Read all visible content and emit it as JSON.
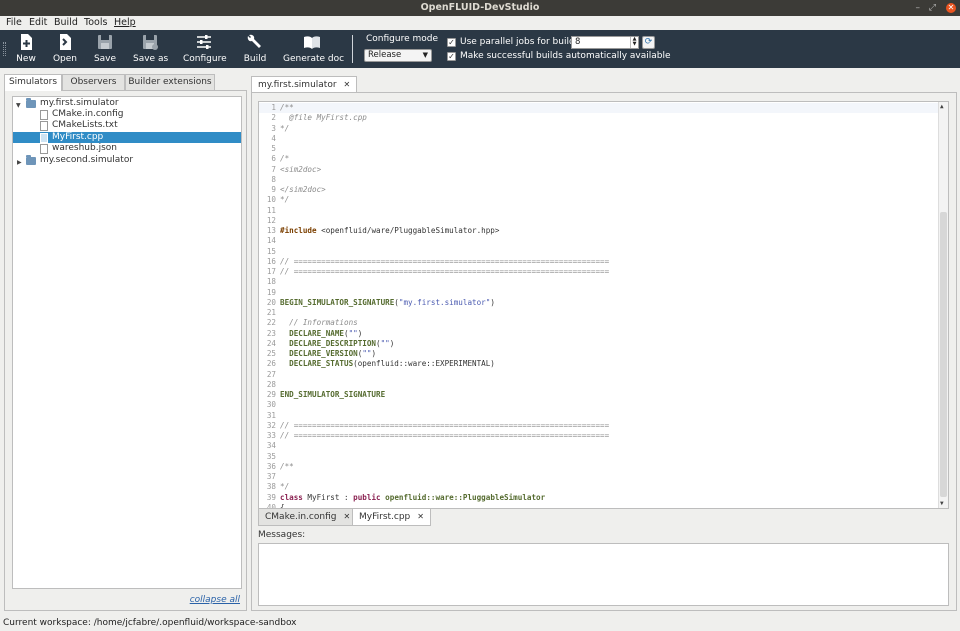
{
  "window": {
    "title": "OpenFLUID-DevStudio",
    "minimize": "–",
    "restore": "⤢",
    "close": "✕"
  },
  "menu": [
    "File",
    "Edit",
    "Build",
    "Tools",
    "Help"
  ],
  "toolbar": {
    "buttons": [
      {
        "label": "New",
        "icon": "new-file-icon"
      },
      {
        "label": "Open",
        "icon": "open-file-icon"
      },
      {
        "label": "Save",
        "icon": "save-icon"
      },
      {
        "label": "Save as",
        "icon": "save-as-icon"
      },
      {
        "label": "Configure",
        "icon": "configure-sliders-icon"
      },
      {
        "label": "Build",
        "icon": "wrench-icon"
      },
      {
        "label": "Generate doc",
        "icon": "book-icon"
      }
    ],
    "configure_mode_label": "Configure mode",
    "configure_mode_value": "Release",
    "parallel_jobs_label": "Use parallel jobs for build :",
    "parallel_jobs_value": "8",
    "parallel_jobs_checked": true,
    "auto_available_label": "Make successful builds automatically available",
    "auto_available_checked": true
  },
  "left_tabs": [
    "Simulators",
    "Observers",
    "Builder extensions"
  ],
  "tree": [
    {
      "label": "my.first.simulator",
      "type": "folder",
      "expanded": true,
      "depth": 0
    },
    {
      "label": "CMake.in.config",
      "type": "file",
      "depth": 1
    },
    {
      "label": "CMakeLists.txt",
      "type": "file",
      "depth": 1
    },
    {
      "label": "MyFirst.cpp",
      "type": "file",
      "depth": 1,
      "selected": true
    },
    {
      "label": "wareshub.json",
      "type": "file",
      "depth": 1
    },
    {
      "label": "my.second.simulator",
      "type": "folder",
      "expanded": false,
      "depth": 0
    }
  ],
  "collapse_all": "collapse all",
  "editor_tab": "my.first.simulator",
  "code_lines": [
    [
      [
        "c-comment",
        "/**"
      ]
    ],
    [
      [
        "c-comment",
        "  @file MyFirst.cpp"
      ]
    ],
    [
      [
        "c-comment",
        "*/"
      ]
    ],
    [],
    [],
    [
      [
        "c-comment",
        "/*"
      ]
    ],
    [
      [
        "c-comment",
        "<sim2doc>"
      ]
    ],
    [],
    [
      [
        "c-comment",
        "</sim2doc>"
      ]
    ],
    [
      [
        "c-comment",
        "*/"
      ]
    ],
    [],
    [],
    [
      [
        "c-directive",
        "#include"
      ],
      [
        "",
        " <openfluid/ware/PluggableSimulator.hpp>"
      ]
    ],
    [],
    [],
    [
      [
        "c-comment",
        "// ====================================================================="
      ]
    ],
    [
      [
        "c-comment",
        "// ====================================================================="
      ]
    ],
    [],
    [],
    [
      [
        "c-macro",
        "BEGIN_SIMULATOR_SIGNATURE"
      ],
      [
        "",
        "("
      ],
      [
        "c-str",
        "\"my.first.simulator\""
      ],
      [
        "",
        ")"
      ]
    ],
    [],
    [
      [
        "c-comment",
        "  // Informations"
      ]
    ],
    [
      [
        "c-macro",
        "  DECLARE_NAME"
      ],
      [
        "",
        "("
      ],
      [
        "c-str",
        "\"\""
      ],
      [
        "",
        ")"
      ]
    ],
    [
      [
        "c-macro",
        "  DECLARE_DESCRIPTION"
      ],
      [
        "",
        "("
      ],
      [
        "c-str",
        "\"\""
      ],
      [
        "",
        ")"
      ]
    ],
    [
      [
        "c-macro",
        "  DECLARE_VERSION"
      ],
      [
        "",
        "("
      ],
      [
        "c-str",
        "\"\""
      ],
      [
        "",
        ")"
      ]
    ],
    [
      [
        "c-macro",
        "  DECLARE_STATUS"
      ],
      [
        "",
        "(openfluid::ware::EXPERIMENTAL)"
      ]
    ],
    [],
    [],
    [
      [
        "c-macro",
        "END_SIMULATOR_SIGNATURE"
      ]
    ],
    [],
    [],
    [
      [
        "c-comment",
        "// ====================================================================="
      ]
    ],
    [
      [
        "c-comment",
        "// ====================================================================="
      ]
    ],
    [],
    [],
    [
      [
        "c-comment",
        "/**"
      ]
    ],
    [],
    [
      [
        "c-comment",
        "*/"
      ]
    ],
    [
      [
        "c-kw",
        "class"
      ],
      [
        "",
        " MyFirst : "
      ],
      [
        "c-kw",
        "public"
      ],
      [
        "",
        " "
      ],
      [
        "c-macro",
        "openfluid::ware::PluggableSimulator"
      ]
    ],
    [
      [
        "",
        "{"
      ]
    ]
  ],
  "bottom_tabs": [
    "CMake.in.config",
    "MyFirst.cpp"
  ],
  "messages_label": "Messages:",
  "status": "Current workspace: /home/jcfabre/.openfluid/workspace-sandbox"
}
